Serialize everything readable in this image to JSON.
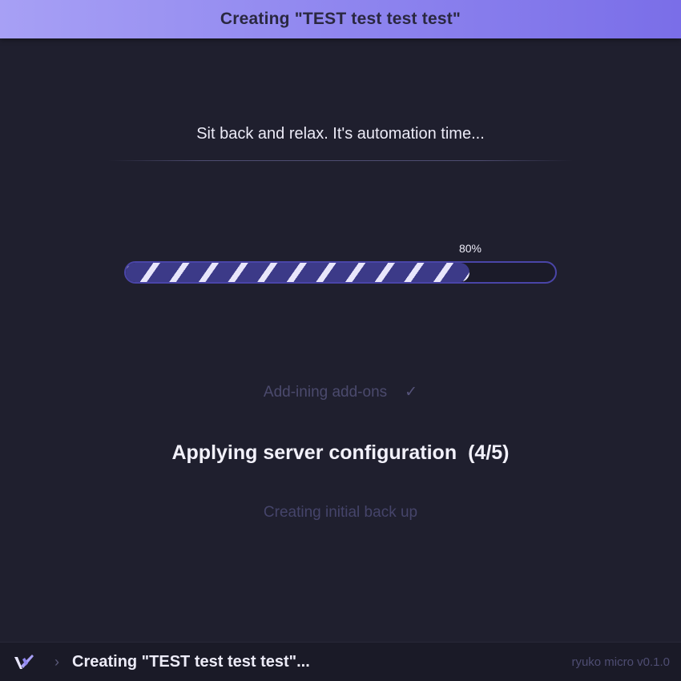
{
  "window": {
    "title": "Creating \"TEST test test test\""
  },
  "main": {
    "tagline": "Sit back and relax. It's automation time...",
    "progress": {
      "percent_label": "80%",
      "value": 0.8
    },
    "steps": {
      "done": {
        "label": "Add-ining add-ons",
        "icon": "check-icon"
      },
      "current": {
        "label": "Applying server configuration",
        "counter": "(4/5)"
      },
      "next": {
        "label": "Creating initial back up"
      }
    }
  },
  "status_bar": {
    "logo_icon": "app-logo-icon",
    "separator": "›",
    "status": "Creating \"TEST test test test\"...",
    "version": "ryuko micro v0.1.0"
  },
  "colors": {
    "accent": "#8f86ef",
    "progress_border": "#4a45a8",
    "background": "#1f1f2e"
  }
}
